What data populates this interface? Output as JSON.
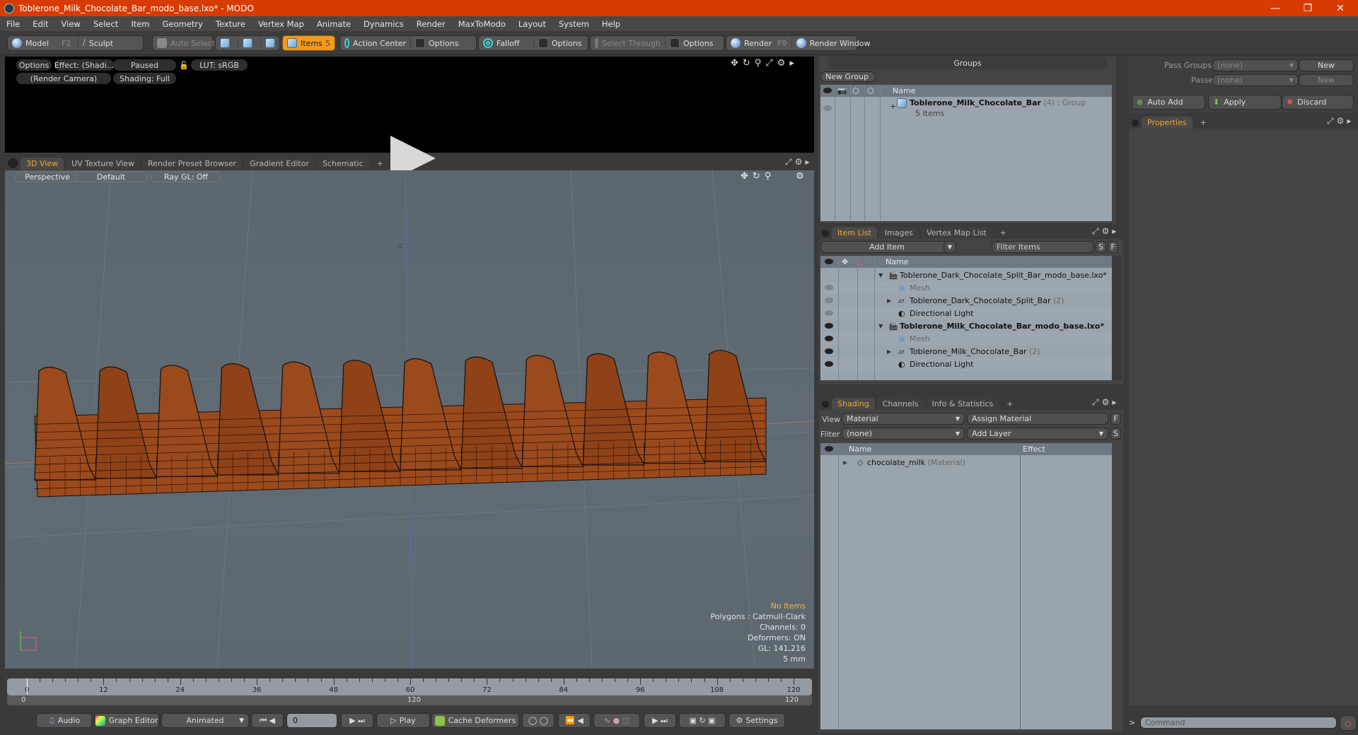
{
  "window": {
    "title": "Toblerone_Milk_Chocolate_Bar_modo_base.lxo* - MODO",
    "controls": [
      "minimize",
      "restore",
      "close"
    ]
  },
  "menu": [
    "File",
    "Edit",
    "View",
    "Select",
    "Item",
    "Geometry",
    "Texture",
    "Vertex Map",
    "Animate",
    "Dynamics",
    "Render",
    "MaxToModo",
    "Layout",
    "System",
    "Help"
  ],
  "toolbar": {
    "model": "Model",
    "model_key": "F2",
    "sculpt": "Sculpt",
    "auto_select": "Auto Select",
    "items": "Items",
    "items_count": "5",
    "action_center": "Action Center",
    "options1": "Options",
    "falloff": "Falloff",
    "options2": "Options",
    "select_through": "Select Through",
    "options3": "Options",
    "render": "Render",
    "render_key": "F9",
    "render_window": "Render Window"
  },
  "render_preview": {
    "options": "Options",
    "effect": "Effect: (Shadi...",
    "status": "Paused",
    "lut": "LUT: sRGB",
    "camera": "(Render Camera)",
    "shading": "Shading: Full"
  },
  "viewport_tabs": [
    "3D View",
    "UV Texture View",
    "Render Preset Browser",
    "Gradient Editor",
    "Schematic",
    "+"
  ],
  "viewport": {
    "projection": "Perspective",
    "style": "Default",
    "raygl": "Ray GL: Off",
    "axis_label": "-Z",
    "info": {
      "selection": "No Items",
      "polygons": "Polygons : Catmull-Clark",
      "channels": "Channels: 0",
      "deformers": "Deformers: ON",
      "gl": "GL: 141,216",
      "scale": "5 mm"
    }
  },
  "timeline": {
    "ticks": [
      "0",
      "12",
      "24",
      "36",
      "48",
      "60",
      "72",
      "84",
      "96",
      "108",
      "120"
    ],
    "range_start": "0",
    "range_mid": "120",
    "range_end": "120"
  },
  "transport": {
    "audio": "Audio",
    "graph_editor": "Graph Editor",
    "mode": "Animated",
    "frame": "0",
    "play": "Play",
    "cache": "Cache Deformers",
    "settings": "Settings"
  },
  "groups": {
    "title": "Groups",
    "new_group": "New Group",
    "col_name": "Name",
    "rows": [
      {
        "name": "Toblerone_Milk_Chocolate_Bar",
        "count": "(4)",
        "type": ": Group",
        "sub": "5 Items"
      }
    ]
  },
  "pass": {
    "pass_groups_label": "Pass Groups",
    "pass_groups_value": "(none)",
    "passes_label": "Passes",
    "passes_value": "(none)",
    "new": "New",
    "auto_add": "Auto Add",
    "apply": "Apply",
    "discard": "Discard"
  },
  "properties": {
    "tab": "Properties"
  },
  "item_list": {
    "tabs": [
      "Item List",
      "Images",
      "Vertex Map List",
      "+"
    ],
    "add_item": "Add Item",
    "filter_placeholder": "Filter Items",
    "s": "S",
    "f": "F",
    "col_name": "Name",
    "rows": [
      {
        "name": "Toblerone_Dark_Chocolate_Split_Bar_modo_base.lxo*",
        "suffix": "",
        "level": 0,
        "kind": "scene",
        "bold": false
      },
      {
        "name": "Mesh",
        "suffix": "",
        "level": 1,
        "kind": "mesh",
        "bold": false
      },
      {
        "name": "Toblerone_Dark_Chocolate_Split_Bar",
        "suffix": "(2)",
        "level": 1,
        "kind": "group",
        "bold": false
      },
      {
        "name": "Directional Light",
        "suffix": "",
        "level": 1,
        "kind": "light",
        "bold": false
      },
      {
        "name": "Toblerone_Milk_Chocolate_Bar_modo_base.lxo*",
        "suffix": "",
        "level": 0,
        "kind": "scene",
        "bold": true
      },
      {
        "name": "Mesh",
        "suffix": "",
        "level": 1,
        "kind": "mesh",
        "bold": false
      },
      {
        "name": "Toblerone_Milk_Chocolate_Bar",
        "suffix": "(2)",
        "level": 1,
        "kind": "group",
        "bold": false
      },
      {
        "name": "Directional Light",
        "suffix": "",
        "level": 1,
        "kind": "light",
        "bold": false
      }
    ]
  },
  "shading": {
    "tabs": [
      "Shading",
      "Channels",
      "Info & Statistics",
      "+"
    ],
    "view_label": "View",
    "view_value": "Material",
    "assign": "Assign Material",
    "f": "F",
    "filter_label": "Filter",
    "filter_value": "(none)",
    "add_layer": "Add Layer",
    "s": "S",
    "col_name": "Name",
    "col_effect": "Effect",
    "rows": [
      {
        "name": "chocolate_milk",
        "type": "(Material)"
      }
    ]
  },
  "command": {
    "prompt": ">",
    "placeholder": "Command"
  },
  "colors": {
    "titlebar": "#d83b01",
    "accent": "#f19a1e",
    "tab_active": "#f3a531",
    "chocolate": "#9c4a1c"
  }
}
